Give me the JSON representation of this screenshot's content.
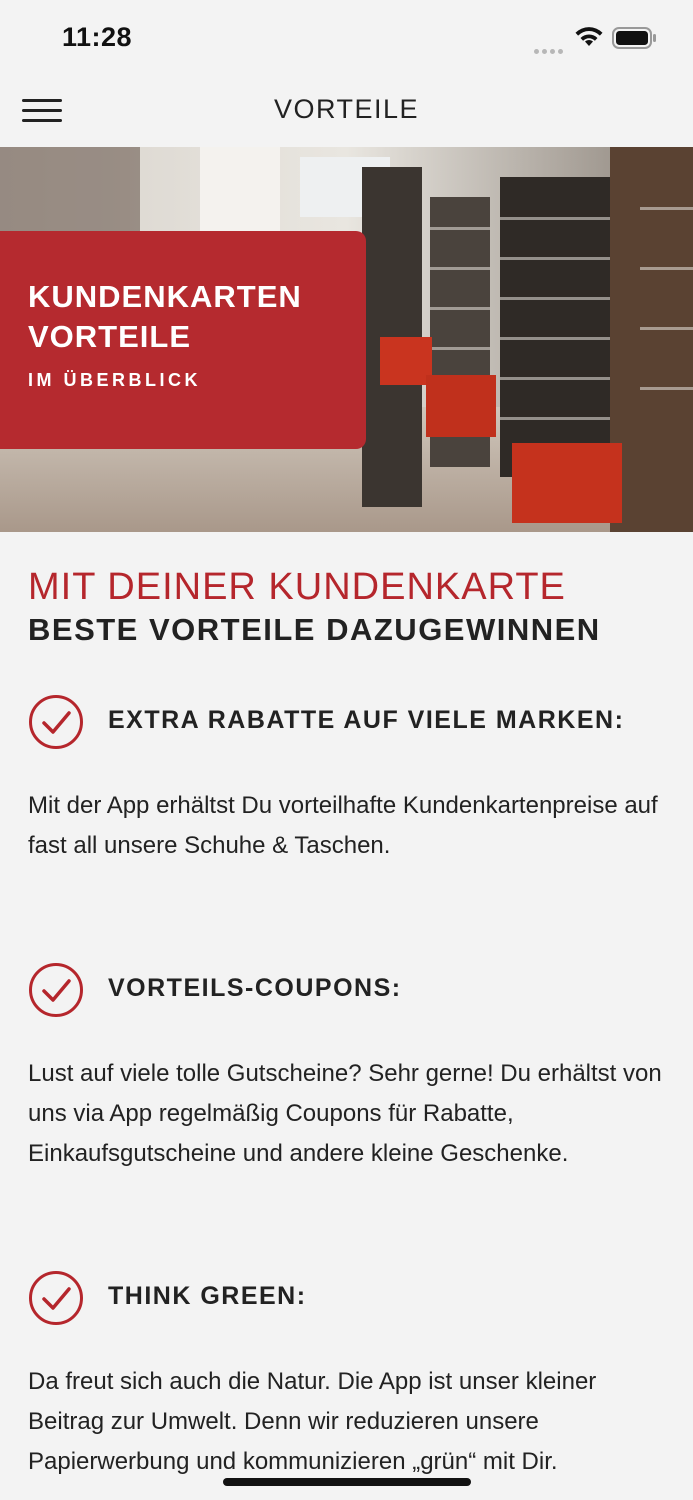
{
  "status": {
    "time": "11:28"
  },
  "nav": {
    "title": "VORTEILE"
  },
  "hero": {
    "title_line1": "KUNDENKARTEN",
    "title_line2": "VORTEILE",
    "subtitle": "IM ÜBERBLICK"
  },
  "headline": {
    "red": "MIT DEINER KUNDENKARTE",
    "dark": "BESTE VORTEILE DAZUGEWINNEN"
  },
  "benefits": [
    {
      "title": "EXTRA RABATTE AUF VIELE MARKEN:",
      "text": "Mit der App erhältst Du vorteilhafte Kundenkartenpreise auf fast all unsere Schuhe & Taschen."
    },
    {
      "title": "VORTEILS-COUPONS:",
      "text": "Lust auf viele tolle Gutscheine? Sehr gerne! Du erhältst von uns via App regelmäßig Coupons für Rabatte, Einkaufsgutscheine und andere kleine Geschenke."
    },
    {
      "title": "THINK GREEN:",
      "text": "Da freut sich auch die Natur. Die App ist unser kleiner Beitrag zur Umwelt. Denn wir reduzieren unsere Papierwerbung und kommunizieren „grün“ mit Dir."
    }
  ],
  "colors": {
    "accent": "#b52a2f",
    "background": "#f3f3f3",
    "text": "#222222"
  },
  "icons": {
    "menu": "hamburger-icon",
    "check": "check-circle-icon",
    "wifi": "wifi-icon",
    "battery": "battery-icon",
    "signal": "signal-icon"
  }
}
